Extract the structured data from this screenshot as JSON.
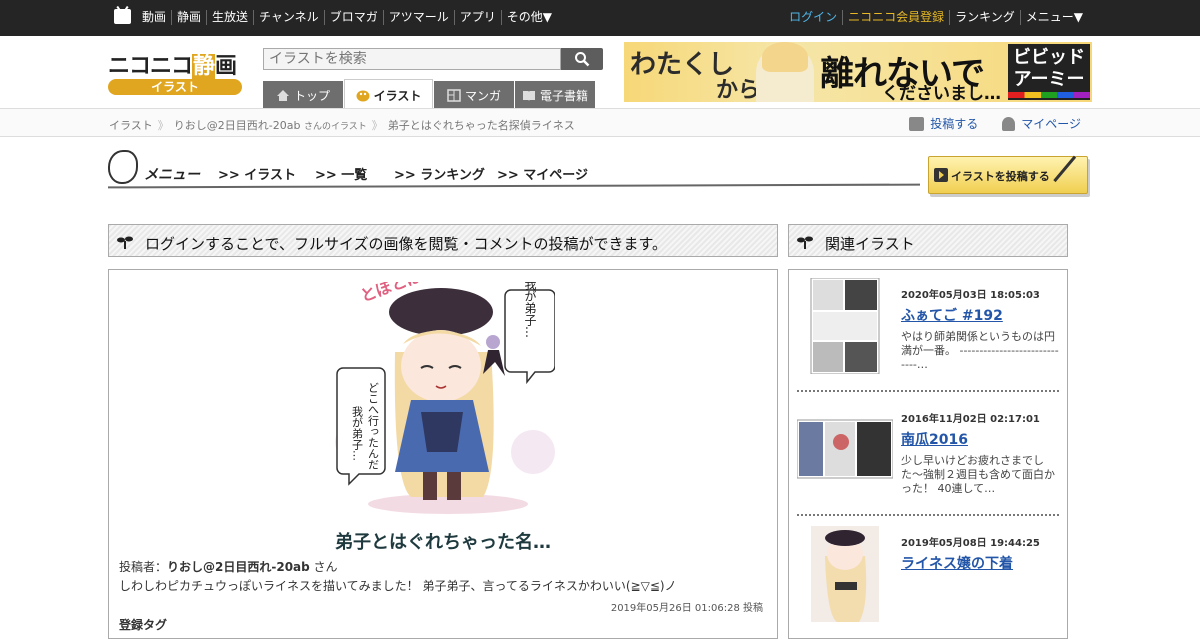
{
  "topbar": {
    "left_links": [
      "動画",
      "静画",
      "生放送",
      "チャンネル",
      "ブロマガ",
      "アツマール",
      "アプリ",
      "その他▼"
    ],
    "login": "ログイン",
    "register": "ニコニコ会員登録",
    "ranking": "ランキング",
    "menu": "メニュー▼"
  },
  "logo": {
    "word_a": "ニコニコ",
    "word_b": "静",
    "word_c": "画",
    "section": "イラスト"
  },
  "search": {
    "placeholder": "イラストを検索"
  },
  "tabs": [
    "トップ",
    "イラスト",
    "マンガ",
    "電子書籍"
  ],
  "banner": {
    "line1": "わたくし",
    "line2": "から",
    "big": "離れないで",
    "sub": "くださいまし…",
    "brand": "ビビッドアーミー"
  },
  "breadcrumb": {
    "root": "イラスト",
    "user": "りおし@2日目西れ-20ab",
    "user_suffix": "さんのイラスト",
    "current": "弟子とはぐれちゃった名探偵ライネス",
    "post": "投稿する",
    "mypage": "マイページ"
  },
  "menu": {
    "title": "メニュー",
    "items": [
      ">> イラスト",
      ">> 一覧",
      ">> ランキング",
      ">> マイページ"
    ],
    "post_button": "イラストを投稿する"
  },
  "notice": "ログインすることで、フルサイズの画像を閲覧・コメントの投稿ができます。",
  "related_header": "関連イラスト",
  "artwork": {
    "bubble1": "我が弟子…",
    "bubble2": "どこへ行ったんだ我が弟子…",
    "sfx": "とぼとぼ…",
    "title": "弟子とはぐれちゃった名…",
    "poster_label": "投稿者：",
    "poster_name": "りおし@2日目西れ-20ab",
    "poster_suffix": " さん",
    "description": "しわしわピカチュウっぽいライネスを描いてみました！ 弟子弟子、言ってるライネスかわいい(≧▽≦)ノ",
    "date": "2019年05月26日 01:06:28 投稿",
    "tags_label": "登録タグ"
  },
  "related": [
    {
      "date": "2020年05月03日 18:05:03",
      "title": "ふぁてご #192",
      "text": "やはり師弟関係というものは円満が一番。 -----------------------------…"
    },
    {
      "date": "2016年11月02日 02:17:01",
      "title": "南瓜2016",
      "text": "少し早いけどお疲れさまでした〜強制２週目も含めて面白かった！ 40連して…"
    },
    {
      "date": "2019年05月08日 19:44:25",
      "title": "ライネス嬢の下着",
      "text": ""
    }
  ]
}
